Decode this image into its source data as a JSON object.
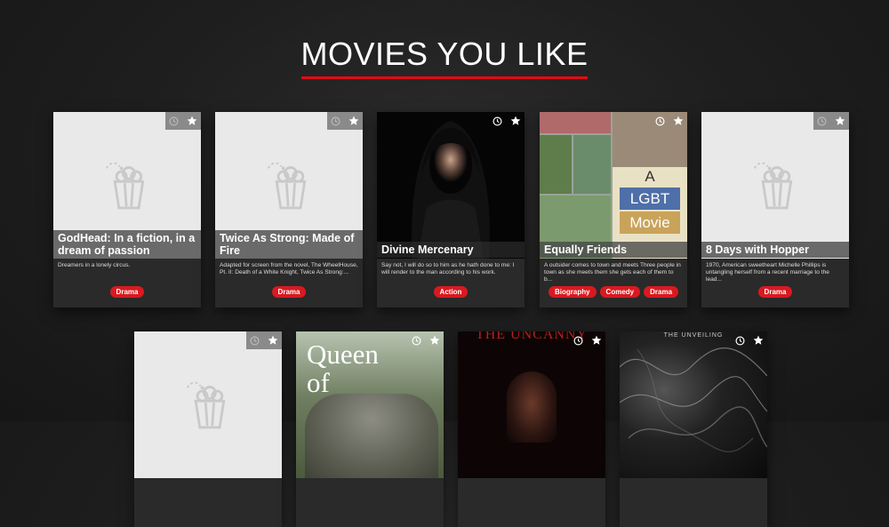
{
  "heading": "MOVIES YOU LIKE",
  "colors": {
    "accent": "#e50914",
    "tag": "#d81a20",
    "card_bg": "#2a2a2a",
    "placeholder_bg": "#e9e9e9"
  },
  "icons": {
    "watch_later": "clock-icon",
    "favorite": "star-icon",
    "placeholder": "popcorn-icon"
  },
  "movies": [
    {
      "title": "GodHead: In a fiction, in a dream of passion",
      "description": "Dreamers in a lonely circus.",
      "genres": [
        "Drama"
      ],
      "poster": "placeholder"
    },
    {
      "title": "Twice As Strong: Made of Fire",
      "description": "Adapted for screen from the novel, The WheelHouse, Pt. II: Death of a White Knight, Twice As Strong:...",
      "genres": [
        "Drama"
      ],
      "poster": "placeholder"
    },
    {
      "title": "Divine Mercenary",
      "description": "Say not, I will do so to him as he hath done to me: I will render to the man according to his work.",
      "genres": [
        "Action"
      ],
      "poster": "hooded-woman"
    },
    {
      "title": "Equally Friends",
      "description": "A outsider comes to town and meets Three people in town as she meets them she gets each of them to b...",
      "genres": [
        "Biography",
        "Comedy",
        "Drama"
      ],
      "poster": "collage",
      "poster_text": [
        "A",
        "LGBT",
        "Movie"
      ]
    },
    {
      "title": "8 Days with Hopper",
      "description": "1970, American sweetheart Michelle Phillips is untangling herself from a recent marriage to the lead...",
      "genres": [
        "Drama"
      ],
      "poster": "placeholder"
    }
  ],
  "movies_row2": [
    {
      "poster": "placeholder"
    },
    {
      "poster": "queen",
      "poster_text": [
        "Queen",
        "of"
      ]
    },
    {
      "poster": "uncanny",
      "poster_text": "THE UNCANNY"
    },
    {
      "poster": "smoke",
      "poster_text": "THE UNVEILING"
    }
  ]
}
